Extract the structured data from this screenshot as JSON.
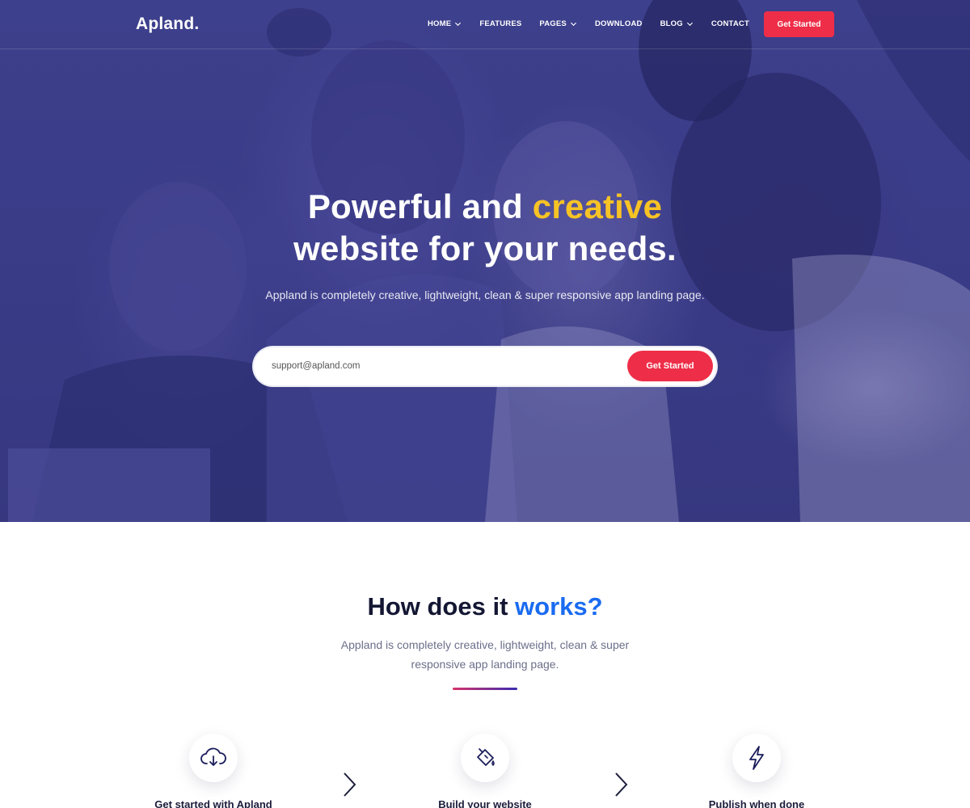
{
  "nav": {
    "logo": "Apland.",
    "menu": [
      {
        "label": "HOME",
        "has_dropdown": true
      },
      {
        "label": "FEATURES",
        "has_dropdown": false
      },
      {
        "label": "PAGES",
        "has_dropdown": true
      },
      {
        "label": "DOWNLOAD",
        "has_dropdown": false
      },
      {
        "label": "BLOG",
        "has_dropdown": true
      },
      {
        "label": "CONTACT",
        "has_dropdown": false
      }
    ],
    "cta_label": "Get Started"
  },
  "hero": {
    "title_part1": "Powerful and ",
    "title_accent": "creative",
    "title_line2": "website for your needs.",
    "subtitle": "Appland is completely creative, lightweight, clean & super responsive app landing page.",
    "email_value": "support@apland.com",
    "email_placeholder": "support@apland.com",
    "button_label": "Get Started"
  },
  "how": {
    "title_part1": "How does it ",
    "title_accent": "works?",
    "subtitle": "Appland is completely creative, lightweight, clean & super responsive app landing page.",
    "steps": [
      {
        "label": "Get started with Apland",
        "icon": "cloud-download-icon"
      },
      {
        "label": "Build your website",
        "icon": "paint-bucket-icon"
      },
      {
        "label": "Publish when done",
        "icon": "lightning-icon"
      }
    ]
  },
  "colors": {
    "accent_red": "#ee2e48",
    "accent_yellow": "#f7c325",
    "accent_blue": "#1a6bf0",
    "hero_overlay": "#3c3f8a"
  }
}
